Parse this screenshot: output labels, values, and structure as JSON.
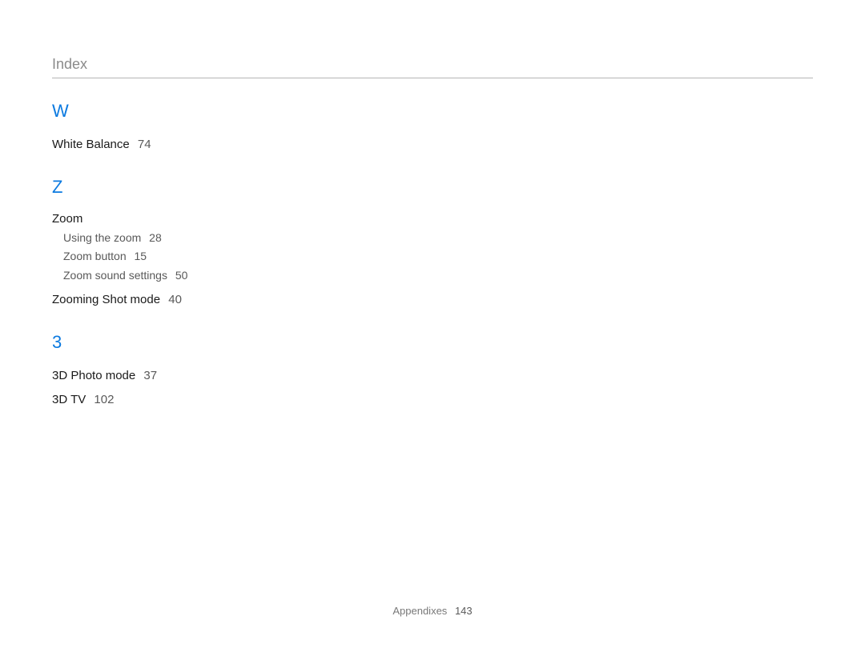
{
  "header": {
    "title": "Index"
  },
  "sections": {
    "w": {
      "letter": "W",
      "white_balance": {
        "label": "White Balance",
        "page": "74"
      }
    },
    "z": {
      "letter": "Z",
      "zoom": {
        "heading": "Zoom",
        "using_the_zoom": {
          "label": "Using the zoom",
          "page": "28"
        },
        "zoom_button": {
          "label": "Zoom button",
          "page": "15"
        },
        "zoom_sound_settings": {
          "label": "Zoom sound settings",
          "page": "50"
        }
      },
      "zooming_shot_mode": {
        "label": "Zooming Shot mode",
        "page": "40"
      }
    },
    "three": {
      "letter": "3",
      "photo_mode_3d": {
        "label": "3D Photo mode",
        "page": "37"
      },
      "tv_3d": {
        "label": "3D TV",
        "page": "102"
      }
    }
  },
  "footer": {
    "section": "Appendixes",
    "page": "143"
  }
}
